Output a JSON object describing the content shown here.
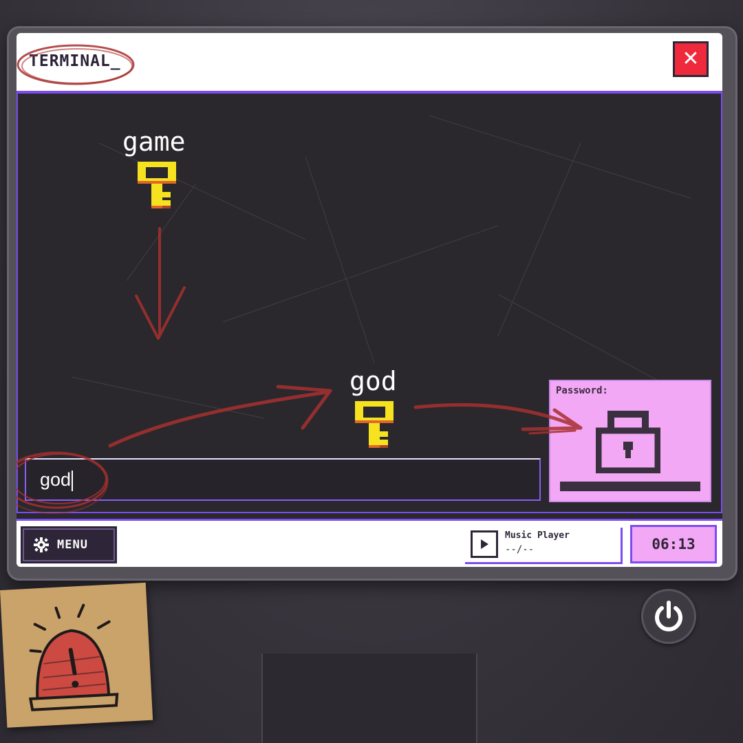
{
  "window": {
    "title": "TERMINAL_",
    "close_symbol": "✕"
  },
  "keys": [
    {
      "label": "game"
    },
    {
      "label": "god"
    }
  ],
  "input": {
    "value": "god"
  },
  "lock_panel": {
    "label": "Password:",
    "icon": "padlock-icon"
  },
  "bottombar": {
    "menu_label": "MENU",
    "music_title": "Music Player",
    "music_track": "--/--",
    "clock": "06:13"
  },
  "colors": {
    "accent": "#7b4cf0",
    "lock_panel": "#f3a8f5",
    "close": "#ee2a3c",
    "key": "#f7e21f",
    "annotation": "#a8302f"
  }
}
